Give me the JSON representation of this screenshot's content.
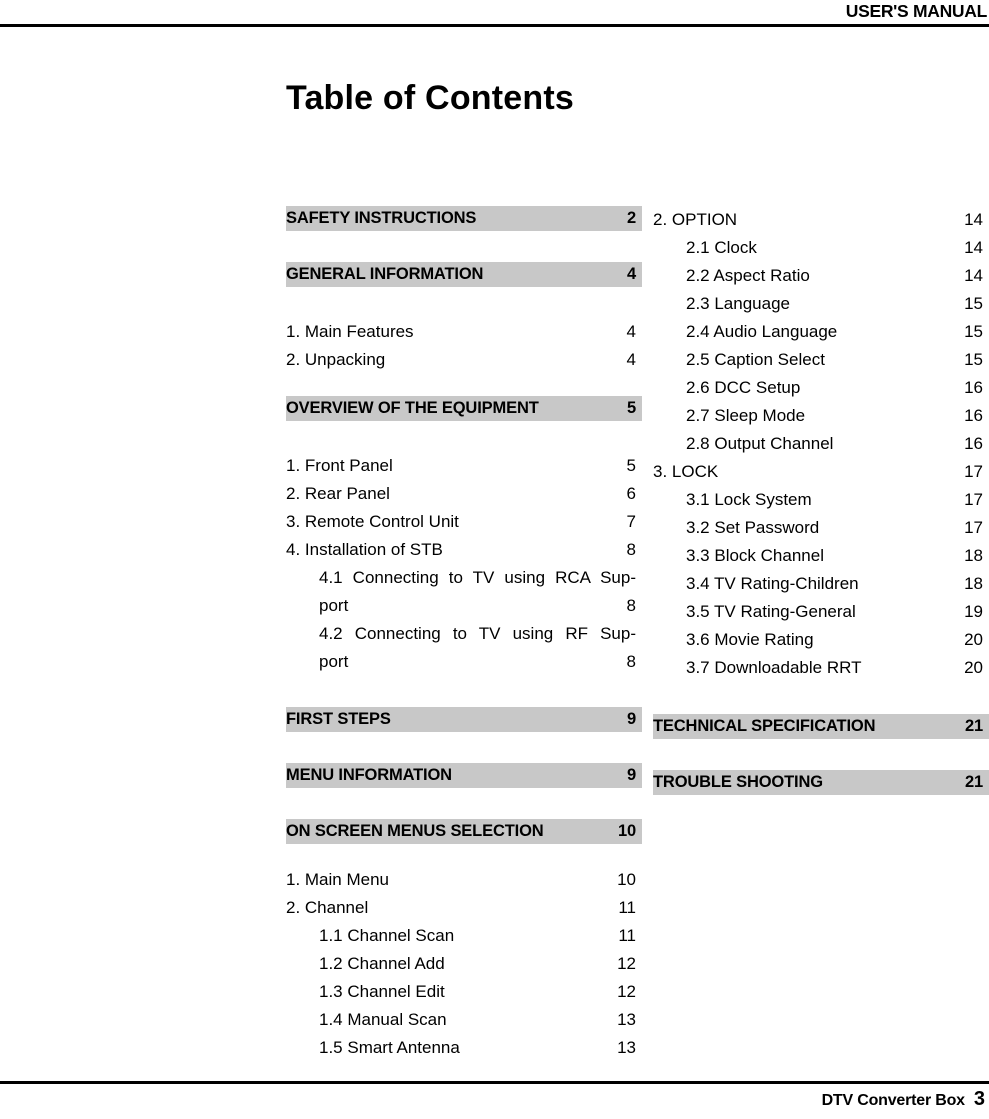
{
  "header": {
    "running_title": "USER'S MANUAL"
  },
  "title": "Table of Contents",
  "left_column": {
    "blocks": [
      {
        "kind": "section-bar",
        "title": "SAFETY INSTRUCTIONS",
        "page": "2"
      },
      {
        "kind": "section-bar",
        "title": "GENERAL INFORMATION",
        "page": "4"
      },
      {
        "kind": "entries",
        "items": [
          {
            "level": 1,
            "label": "1. Main Features",
            "page": "4"
          },
          {
            "level": 1,
            "label": "2. Unpacking",
            "page": "4"
          }
        ]
      },
      {
        "kind": "section-bar",
        "title": "OVERVIEW OF THE EQUIPMENT",
        "page": "5"
      },
      {
        "kind": "entries",
        "items": [
          {
            "level": 1,
            "label": "1. Front Panel",
            "page": "5"
          },
          {
            "level": 1,
            "label": "2. Rear Panel",
            "page": "6"
          },
          {
            "level": 1,
            "label": "3. Remote Control Unit",
            "page": "7"
          },
          {
            "level": 1,
            "label": "4. Installation of STB",
            "page": "8"
          }
        ]
      },
      {
        "kind": "wrapped-entries",
        "items": [
          {
            "line1": "4.1 Connecting to TV using RCA Sup-",
            "line2": "port",
            "page": "8"
          },
          {
            "line1": "4.2 Connecting to TV using  RF Sup-",
            "line2": "port",
            "page": "8"
          }
        ]
      },
      {
        "kind": "section-bar",
        "title": "FIRST STEPS",
        "page": "9"
      },
      {
        "kind": "section-bar",
        "title": "MENU INFORMATION",
        "page": "9"
      },
      {
        "kind": "section-bar",
        "title": "ON SCREEN MENUS SELECTION",
        "page": "10"
      },
      {
        "kind": "entries",
        "items": [
          {
            "level": 1,
            "label": "1. Main Menu",
            "page": "10"
          },
          {
            "level": 1,
            "label": "2. Channel",
            "page": "11"
          },
          {
            "level": 2,
            "label": "1.1 Channel Scan",
            "page": "11"
          },
          {
            "level": 2,
            "label": "1.2 Channel Add",
            "page": "12"
          },
          {
            "level": 2,
            "label": "1.3 Channel Edit",
            "page": "12"
          },
          {
            "level": 2,
            "label": "1.4 Manual Scan",
            "page": "13"
          },
          {
            "level": 2,
            "label": "1.5 Smart Antenna",
            "page": "13"
          }
        ]
      }
    ]
  },
  "right_column": {
    "blocks": [
      {
        "kind": "entries",
        "items": [
          {
            "level": 1,
            "label": "2. OPTION",
            "page": "14"
          },
          {
            "level": 2,
            "label": "2.1 Clock",
            "page": "14"
          },
          {
            "level": 2,
            "label": "2.2 Aspect Ratio",
            "page": "14"
          },
          {
            "level": 2,
            "label": "2.3 Language",
            "page": "15"
          },
          {
            "level": 2,
            "label": "2.4 Audio Language",
            "page": "15"
          },
          {
            "level": 2,
            "label": "2.5 Caption Select",
            "page": "15"
          },
          {
            "level": 2,
            "label": "2.6 DCC Setup",
            "page": "16"
          },
          {
            "level": 2,
            "label": "2.7 Sleep Mode",
            "page": "16"
          },
          {
            "level": 2,
            "label": "2.8 Output Channel",
            "page": "16"
          },
          {
            "level": 1,
            "label": "3. LOCK",
            "page": "17"
          },
          {
            "level": 2,
            "label": "3.1 Lock System",
            "page": "17"
          },
          {
            "level": 2,
            "label": "3.2 Set Password",
            "page": "17"
          },
          {
            "level": 2,
            "label": "3.3 Block Channel",
            "page": "18"
          },
          {
            "level": 2,
            "label": "3.4 TV Rating-Children",
            "page": "18"
          },
          {
            "level": 2,
            "label": "3.5 TV Rating-General",
            "page": "19"
          },
          {
            "level": 2,
            "label": "3.6 Movie Rating",
            "page": "20"
          },
          {
            "level": 2,
            "label": "3.7 Downloadable RRT",
            "page": "20"
          }
        ]
      },
      {
        "kind": "section-bar",
        "title": "TECHNICAL SPECIFICATION",
        "page": "21"
      },
      {
        "kind": "section-bar",
        "title": "TROUBLE SHOOTING",
        "page": "21"
      }
    ]
  },
  "footer": {
    "product": "DTV Converter Box",
    "page_number": "3"
  },
  "colors": {
    "section_bar_bg": "#c8c8c8",
    "text": "#000000",
    "page_bg": "#ffffff"
  }
}
